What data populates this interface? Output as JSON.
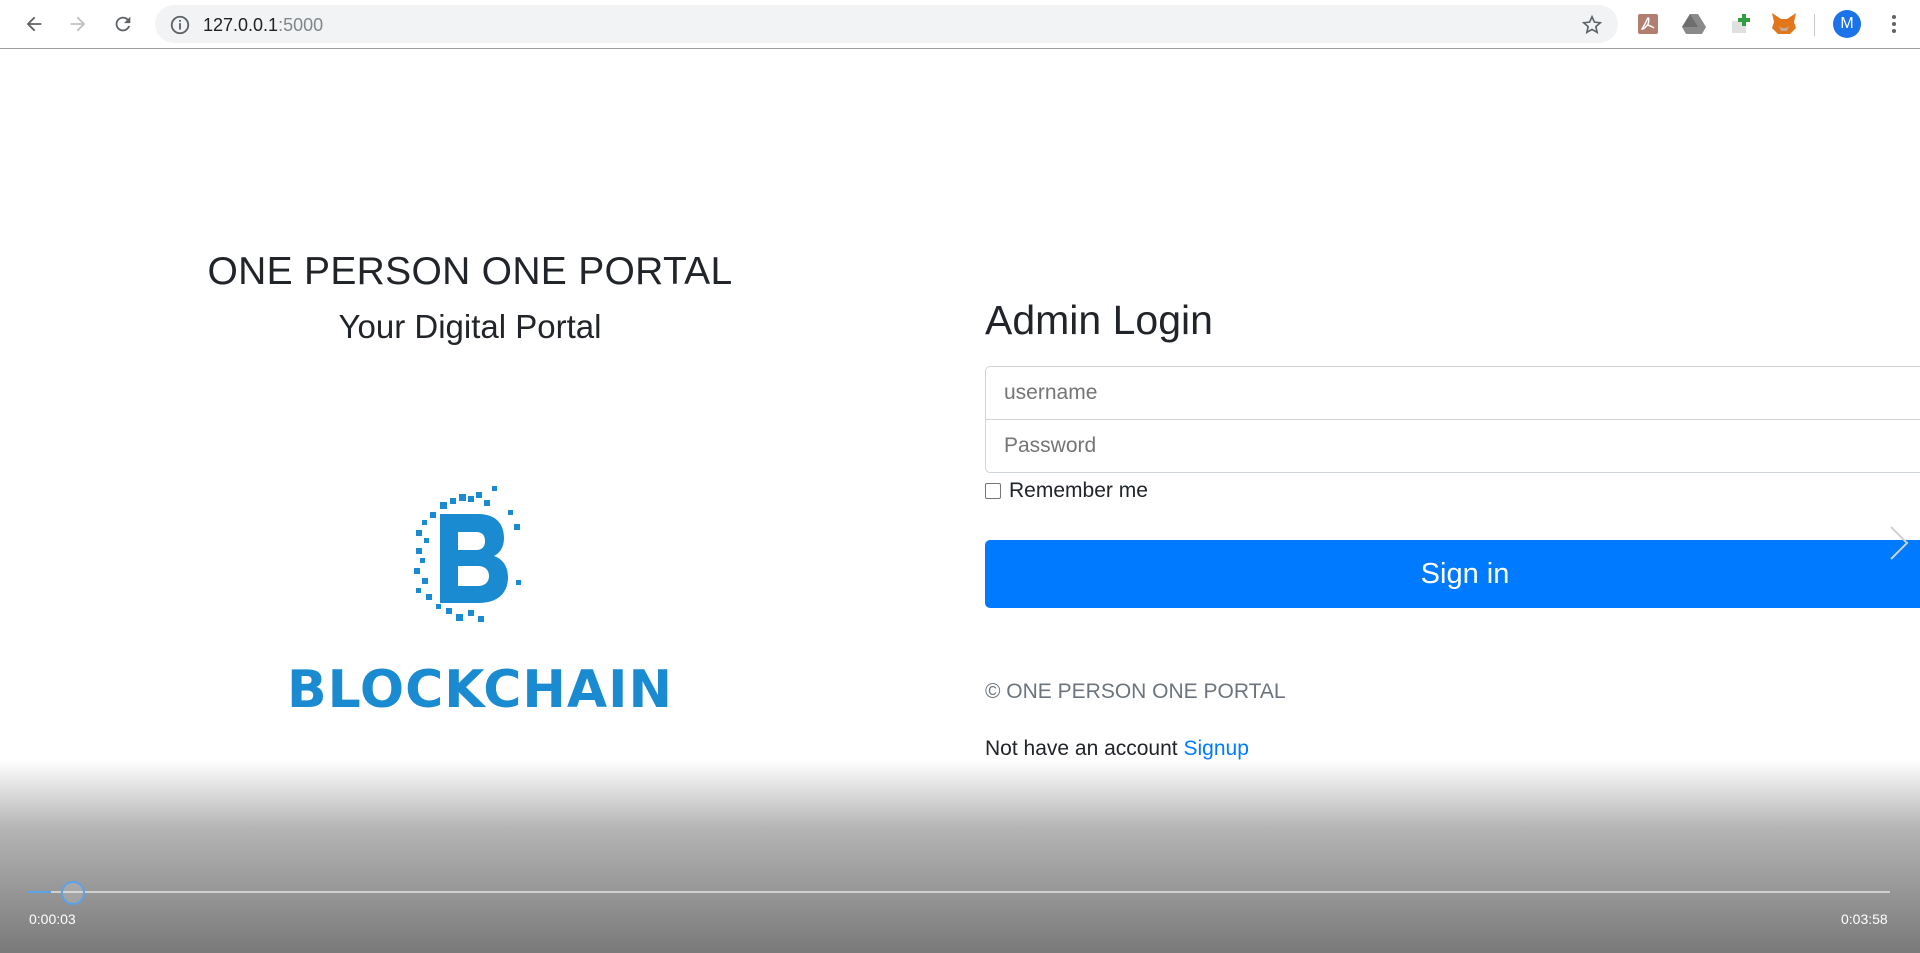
{
  "browser": {
    "url_host": "127.0.0.1",
    "url_port": ":5000",
    "avatar_letter": "M"
  },
  "brand": {
    "title": "ONE PERSON ONE PORTAL",
    "subtitle": "Your Digital Portal",
    "logo_text": "BLOCKCHAIN",
    "logo_color": "#1a8ad1"
  },
  "login": {
    "title": "Admin Login",
    "username_placeholder": "username",
    "password_placeholder": "Password",
    "remember_label": "Remember me",
    "signin_label": "Sign in",
    "copyright": "© ONE PERSON ONE PORTAL",
    "account_prompt": "Not have an account",
    "signup_link": "Signup",
    "accent_color": "#007bff"
  },
  "player": {
    "current_time": "0:00:03",
    "total_time": "0:03:58",
    "progress_fraction": 0.0126
  }
}
